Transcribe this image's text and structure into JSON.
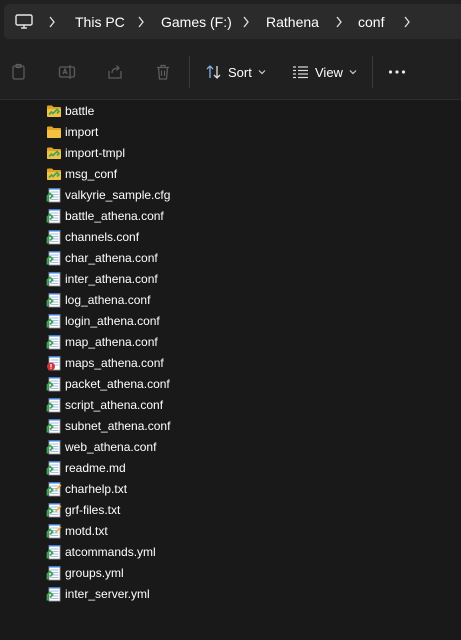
{
  "breadcrumb": [
    "This PC",
    "Games (F:)",
    "Rathena",
    "conf"
  ],
  "toolbar": {
    "sort_label": "Sort",
    "view_label": "View"
  },
  "files": [
    {
      "name": "battle",
      "type": "folder"
    },
    {
      "name": "import",
      "type": "folder-plain"
    },
    {
      "name": "import-tmpl",
      "type": "folder"
    },
    {
      "name": "msg_conf",
      "type": "folder"
    },
    {
      "name": "valkyrie_sample.cfg",
      "type": "notepad"
    },
    {
      "name": "battle_athena.conf",
      "type": "notepad"
    },
    {
      "name": "channels.conf",
      "type": "notepad"
    },
    {
      "name": "char_athena.conf",
      "type": "notepad"
    },
    {
      "name": "inter_athena.conf",
      "type": "notepad"
    },
    {
      "name": "log_athena.conf",
      "type": "notepad"
    },
    {
      "name": "login_athena.conf",
      "type": "notepad"
    },
    {
      "name": "map_athena.conf",
      "type": "notepad"
    },
    {
      "name": "maps_athena.conf",
      "type": "notepad-warning"
    },
    {
      "name": "packet_athena.conf",
      "type": "notepad"
    },
    {
      "name": "script_athena.conf",
      "type": "notepad"
    },
    {
      "name": "subnet_athena.conf",
      "type": "notepad"
    },
    {
      "name": "web_athena.conf",
      "type": "notepad"
    },
    {
      "name": "readme.md",
      "type": "notepad"
    },
    {
      "name": "charhelp.txt",
      "type": "text"
    },
    {
      "name": "grf-files.txt",
      "type": "text"
    },
    {
      "name": "motd.txt",
      "type": "text"
    },
    {
      "name": "atcommands.yml",
      "type": "notepad"
    },
    {
      "name": "groups.yml",
      "type": "notepad"
    },
    {
      "name": "inter_server.yml",
      "type": "notepad"
    }
  ],
  "colors": {
    "background": "#191919",
    "toolbar": "#202020",
    "address_box": "#2b2b2b",
    "folder": "#f5c142",
    "notepad_green": "#3aa655",
    "warning_red": "#d13438"
  }
}
